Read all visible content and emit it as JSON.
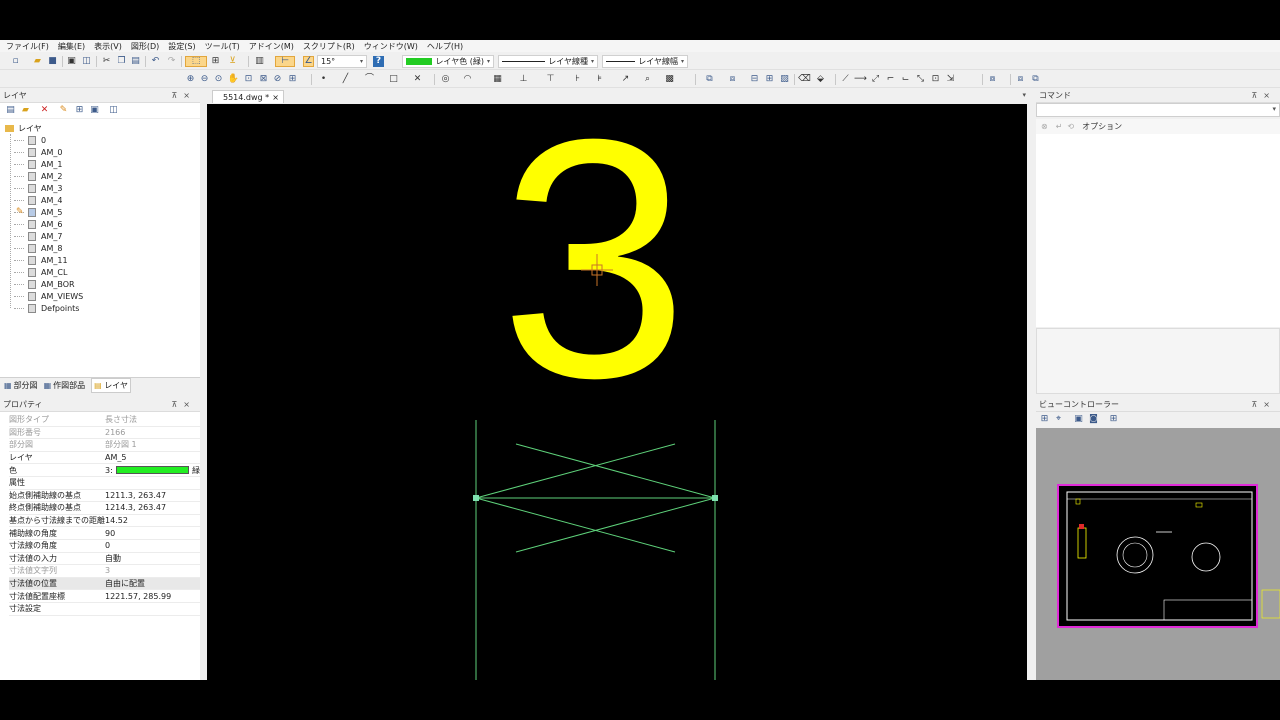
{
  "menu": [
    "ファイル(F)",
    "編集(E)",
    "表示(V)",
    "図形(D)",
    "設定(S)",
    "ツール(T)",
    "アドイン(M)",
    "スクリプト(R)",
    "ウィンドウ(W)",
    "ヘルプ(H)"
  ],
  "toolbar": {
    "angle_value": "15°",
    "layer_color_label": "レイヤ色 (緑)",
    "linetype_label": "レイヤ線種",
    "lineweight_label": "レイヤ線幅",
    "layer_color": "#22cc22"
  },
  "document_tab": {
    "label": "5514.dwg *",
    "close": "×"
  },
  "layer_panel": {
    "title": "レイヤ",
    "root": "レイヤ",
    "items": [
      "0",
      "AM_0",
      "AM_1",
      "AM_2",
      "AM_3",
      "AM_4",
      "AM_5",
      "AM_6",
      "AM_7",
      "AM_8",
      "AM_11",
      "AM_CL",
      "AM_BOR",
      "AM_VIEWS",
      "Defpoints"
    ],
    "current": "AM_5",
    "bottom_tabs": [
      "部分図",
      "作図部品",
      "レイヤ"
    ]
  },
  "properties_panel": {
    "title": "プロパティ",
    "rows": [
      {
        "key": "図形タイプ",
        "value": "長さ寸法",
        "dim": true
      },
      {
        "key": "図形番号",
        "value": "2166",
        "dim": true
      },
      {
        "key": "部分図",
        "value": "部分図 1",
        "dim": true
      },
      {
        "key": "レイヤ",
        "value": "AM_5",
        "dim": false
      },
      {
        "key": "色",
        "value": "3:",
        "dim": false
      },
      {
        "key": "属性",
        "value": "",
        "dim": false
      },
      {
        "key": "始点側補助線の基点",
        "value": "1211.3, 263.47",
        "dim": false
      },
      {
        "key": "終点側補助線の基点",
        "value": "1214.3, 263.47",
        "dim": false
      },
      {
        "key": "基点から寸法線までの距離",
        "value": "14.52",
        "dim": false
      },
      {
        "key": "補助線の角度",
        "value": "90",
        "dim": false
      },
      {
        "key": "寸法線の角度",
        "value": "0",
        "dim": false
      },
      {
        "key": "寸法値の入力",
        "value": "自動",
        "dim": false
      },
      {
        "key": "寸法値文字列",
        "value": "3",
        "dim": true
      },
      {
        "key": "寸法値の位置",
        "value": "自由に配置",
        "dim": false
      },
      {
        "key": "寸法値配置座標",
        "value": "1221.57, 285.99",
        "dim": false
      },
      {
        "key": "寸法設定",
        "value": "",
        "dim": false
      }
    ],
    "color_suffix": "緑",
    "color_swatch": "#22ee22"
  },
  "command_panel": {
    "title": "コマンド",
    "option_label": "オプション"
  },
  "view_controller": {
    "title": "ビューコントローラー"
  },
  "canvas": {
    "dimension_text": "3",
    "text_color": "#ffff00",
    "line_color": "#5ed17a"
  }
}
